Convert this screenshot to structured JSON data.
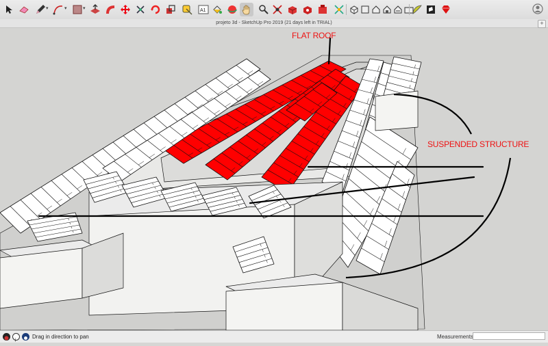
{
  "window": {
    "title": "projeto 3d - SketchUp Pro 2019 (21 days left in TRIAL)",
    "new_tab_label": "+"
  },
  "toolbar": {
    "tools": [
      {
        "name": "select-tool-icon",
        "glyph": "➤"
      },
      {
        "name": "eraser-tool-icon",
        "glyph": "▰"
      },
      {
        "name": "pencil-tool-icon",
        "glyph": "✎"
      },
      {
        "name": "arc-tool-icon",
        "glyph": "⌒"
      },
      {
        "name": "rectangle-tool-icon",
        "glyph": "▧"
      },
      {
        "name": "push-pull-tool-icon",
        "glyph": "⇪"
      },
      {
        "name": "offset-tool-icon",
        "glyph": "◤"
      },
      {
        "name": "move-tool-icon",
        "glyph": "✥"
      },
      {
        "name": "follow-me-tool-icon",
        "glyph": "⤧"
      },
      {
        "name": "rotate-tool-icon",
        "glyph": "⟳"
      },
      {
        "name": "scale-tool-icon",
        "glyph": "⤢"
      },
      {
        "name": "tape-measure-tool-icon",
        "glyph": "◢"
      },
      {
        "name": "text-tool-icon",
        "glyph": "A1"
      },
      {
        "name": "paint-bucket-tool-icon",
        "glyph": "◕"
      },
      {
        "name": "orbit-tool-icon",
        "glyph": "◉"
      },
      {
        "name": "pan-tool-icon",
        "glyph": "✋"
      },
      {
        "name": "zoom-tool-icon",
        "glyph": "⌕"
      },
      {
        "name": "zoom-extents-tool-icon",
        "glyph": "⤡"
      },
      {
        "name": "3d-warehouse-icon",
        "glyph": "▣"
      },
      {
        "name": "share-model-icon",
        "glyph": "▣"
      },
      {
        "name": "extension-warehouse-icon",
        "glyph": "▣"
      },
      {
        "name": "section-plane-icon",
        "glyph": "✂"
      },
      {
        "name": "iso-view-icon",
        "glyph": "◈"
      },
      {
        "name": "top-view-icon",
        "glyph": "▢"
      },
      {
        "name": "front-view-icon",
        "glyph": "⌂"
      },
      {
        "name": "right-view-icon",
        "glyph": "◨"
      },
      {
        "name": "back-view-icon",
        "glyph": "◧"
      },
      {
        "name": "left-view-icon",
        "glyph": "▭"
      },
      {
        "name": "style-edge-icon",
        "glyph": "◖"
      },
      {
        "name": "style-face-icon",
        "glyph": "◩"
      },
      {
        "name": "ruby-extension-icon",
        "glyph": "◆"
      }
    ],
    "account_icon": "user-account-icon"
  },
  "viewport": {
    "annotations": {
      "flat_roof": "FLAT ROOF",
      "suspended_structure": "SUSPENDED STRUCTURE"
    },
    "colors": {
      "background": "#d4d4d2",
      "roof_red": "#ff0000",
      "annotation_red": "#ee1111",
      "panel_white": "#ffffff",
      "wall_gray": "#ebebeb"
    }
  },
  "statusbar": {
    "icons": [
      "geo-location-icon",
      "credits-icon",
      "help-icon"
    ],
    "message": "Drag in direction to pan",
    "measurements_label": "Measurements",
    "measurements_value": ""
  }
}
